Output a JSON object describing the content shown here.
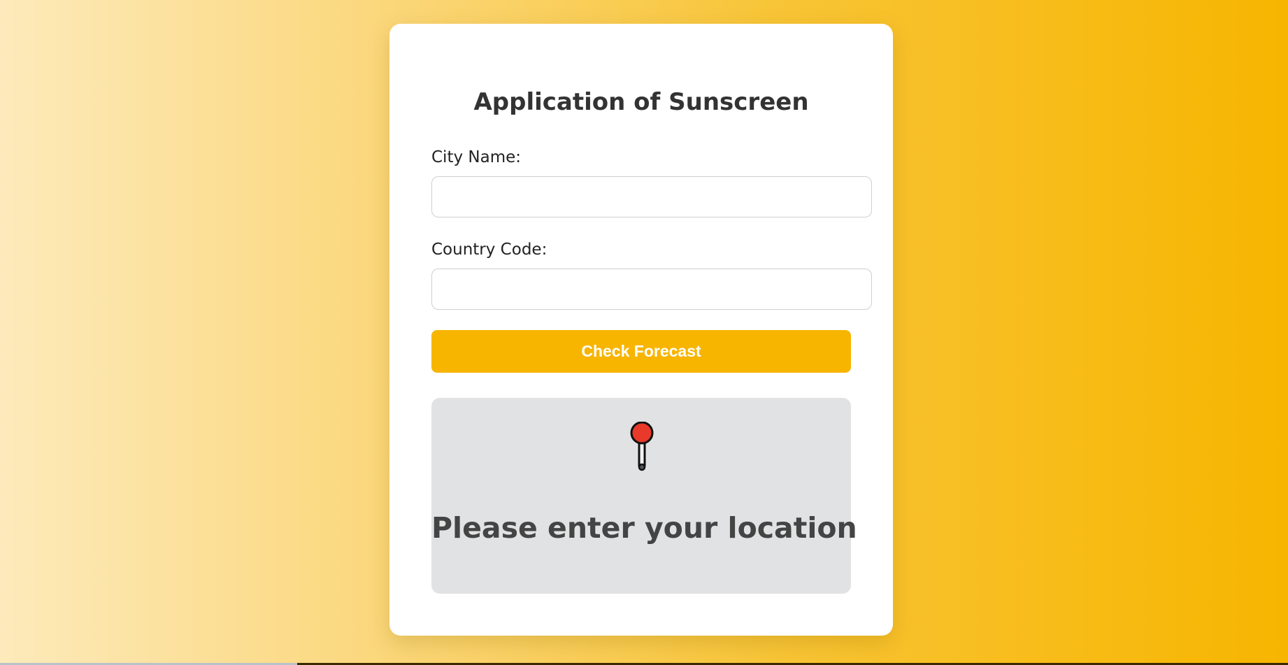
{
  "form": {
    "title": "Application of Sunscreen",
    "city_label": "City Name:",
    "city_value": "",
    "country_label": "Country Code:",
    "country_value": "",
    "submit_label": "Check Forecast"
  },
  "result": {
    "icon": "round-pushpin-icon",
    "message": "Please enter your location"
  },
  "colors": {
    "accent": "#f7b500",
    "card": "#ffffff",
    "result_bg": "#e1e2e4",
    "pin_red": "#e8392a",
    "gradient_start": "#fdeabb",
    "gradient_end": "#f7b500"
  }
}
